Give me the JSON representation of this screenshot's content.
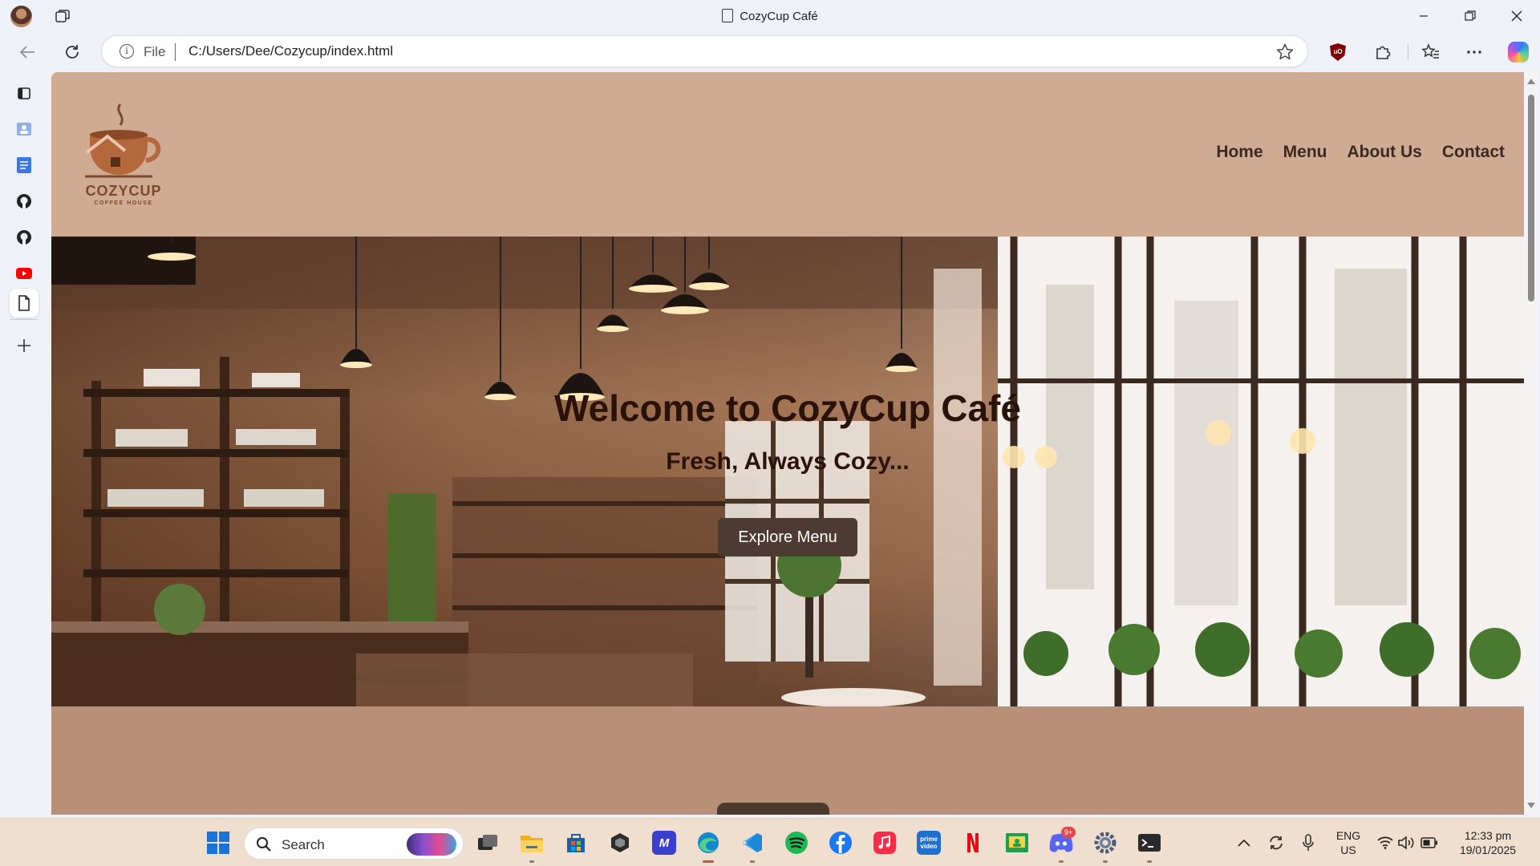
{
  "browser": {
    "window_title": "CozyCup Café",
    "address": {
      "scheme_label": "File",
      "url": "C:/Users/Dee/Cozycup/index.html"
    },
    "sidebar_icons": [
      "workspaces-icon",
      "contacts-icon",
      "docs-icon",
      "github-icon",
      "github-icon",
      "youtube-icon",
      "page-icon",
      "add-icon"
    ]
  },
  "site": {
    "logo": {
      "name": "COZYCUP",
      "tagline": "COFFEE HOUSE"
    },
    "nav": [
      {
        "label": "Home"
      },
      {
        "label": "Menu"
      },
      {
        "label": "About Us"
      },
      {
        "label": "Contact"
      }
    ],
    "hero": {
      "title": "Welcome to CozyCup Café",
      "subtitle": "Fresh, Always Cozy...",
      "cta": "Explore Menu"
    },
    "colors": {
      "header_bg": "#d0ab93",
      "section_bg": "#b89078",
      "text_dark": "#2a1208",
      "button_bg": "#4d3a33"
    }
  },
  "taskbar": {
    "search_placeholder": "Search",
    "apps": [
      "start-icon",
      "task-view-icon",
      "file-explorer-icon",
      "microsoft-store-icon",
      "unity-icon",
      "visual-studio-icon",
      "edge-icon",
      "vscode-icon",
      "spotify-icon",
      "facebook-icon",
      "apple-music-icon",
      "prime-video-icon",
      "netflix-icon",
      "google-classroom-icon",
      "discord-icon",
      "settings-icon",
      "terminal-icon"
    ],
    "discord_badge": "9+",
    "tray": {
      "language": "ENG",
      "region": "US",
      "time": "12:33 pm",
      "date": "19/01/2025"
    }
  }
}
